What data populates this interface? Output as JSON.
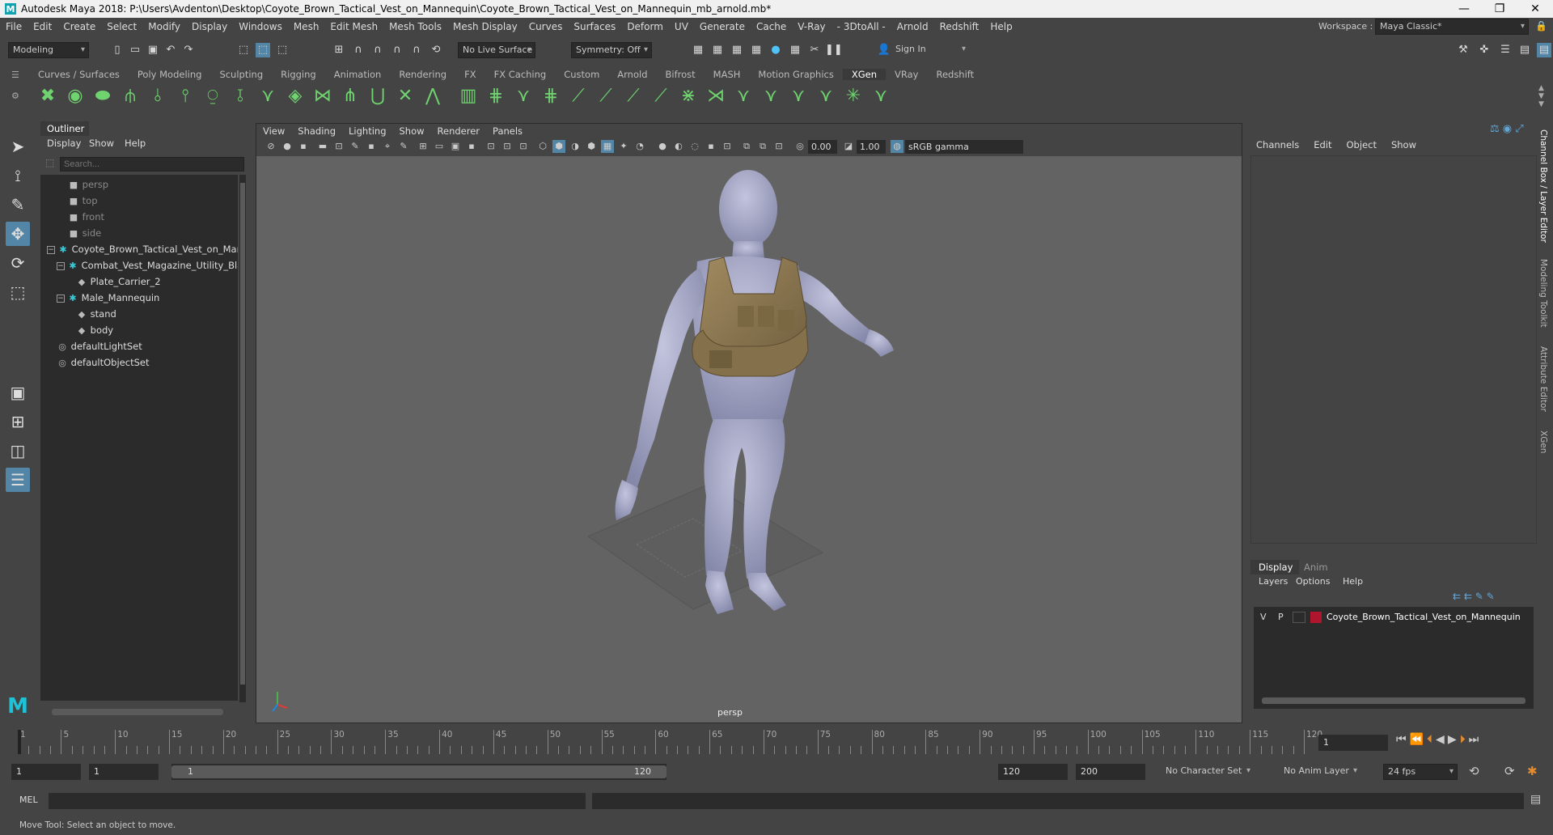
{
  "title_bar": {
    "title": "Autodesk Maya 2018: P:\\Users\\Avdenton\\Desktop\\Coyote_Brown_Tactical_Vest_on_Mannequin\\Coyote_Brown_Tactical_Vest_on_Mannequin_mb_arnold.mb*",
    "logo": "M",
    "minimize": "—",
    "maximize": "❐",
    "close": "✕"
  },
  "menu": [
    "File",
    "Edit",
    "Create",
    "Select",
    "Modify",
    "Display",
    "Windows",
    "Mesh",
    "Edit Mesh",
    "Mesh Tools",
    "Mesh Display",
    "Curves",
    "Surfaces",
    "Deform",
    "UV",
    "Generate",
    "Cache",
    "V-Ray",
    "- 3DtoAll -",
    "Arnold",
    "Redshift",
    "Help"
  ],
  "workspace": {
    "label": "Workspace :",
    "value": "Maya Classic*"
  },
  "status_line": {
    "mode": "Modeling",
    "live_surface": "No Live Surface",
    "symmetry": "Symmetry: Off",
    "sign_in": "Sign In"
  },
  "shelf_tabs": [
    "Curves / Surfaces",
    "Poly Modeling",
    "Sculpting",
    "Rigging",
    "Animation",
    "Rendering",
    "FX",
    "FX Caching",
    "Custom",
    "Arnold",
    "Bifrost",
    "MASH",
    "Motion Graphics",
    "XGen",
    "VRay",
    "Redshift"
  ],
  "shelf_active": "XGen",
  "outliner": {
    "title": "Outliner",
    "menu": [
      "Display",
      "Show",
      "Help"
    ],
    "search_placeholder": "Search...",
    "items": [
      {
        "label": "persp",
        "icon": "camera-icon",
        "dim": true
      },
      {
        "label": "top",
        "icon": "camera-icon",
        "dim": true
      },
      {
        "label": "front",
        "icon": "camera-icon",
        "dim": true
      },
      {
        "label": "side",
        "icon": "camera-icon",
        "dim": true
      },
      {
        "label": "Coyote_Brown_Tactical_Vest_on_Man",
        "icon": "group-icon",
        "dim": false
      },
      {
        "label": "Combat_Vest_Magazine_Utility_Bla",
        "icon": "group-icon",
        "dim": false
      },
      {
        "label": "Plate_Carrier_2",
        "icon": "mesh-icon",
        "dim": false
      },
      {
        "label": "Male_Mannequin",
        "icon": "group-icon",
        "dim": false
      },
      {
        "label": "stand",
        "icon": "mesh-icon",
        "dim": false
      },
      {
        "label": "body",
        "icon": "mesh-icon",
        "dim": false
      },
      {
        "label": "defaultLightSet",
        "icon": "set-icon",
        "dim": false
      },
      {
        "label": "defaultObjectSet",
        "icon": "set-icon",
        "dim": false
      }
    ]
  },
  "viewport": {
    "menu": [
      "View",
      "Shading",
      "Lighting",
      "Show",
      "Renderer",
      "Panels"
    ],
    "exposure": "0.00",
    "gamma": "1.00",
    "color_space": "sRGB gamma",
    "camera": "persp"
  },
  "channel_box": {
    "menu": [
      "Channels",
      "Edit",
      "Object",
      "Show"
    ],
    "vertical_tabs": [
      "Channel Box / Layer Editor",
      "Modeling Toolkit",
      "Attribute Editor",
      "XGen"
    ]
  },
  "layer_editor": {
    "tabs": [
      "Display",
      "Anim"
    ],
    "menu": [
      "Layers",
      "Options",
      "Help"
    ],
    "layer": {
      "v": "V",
      "p": "P",
      "name": "Coyote_Brown_Tactical_Vest_on_Mannequin",
      "color": "#b0152e"
    }
  },
  "time_slider": {
    "labels": [
      "1",
      "5",
      "10",
      "15",
      "20",
      "25",
      "30",
      "35",
      "40",
      "45",
      "50",
      "55",
      "60",
      "65",
      "70",
      "75",
      "80",
      "85",
      "90",
      "95",
      "100",
      "105",
      "110",
      "115",
      "120"
    ],
    "current_frame": "1"
  },
  "range_slider": {
    "start": "1",
    "playback_start": "1",
    "range_start": "1",
    "range_end": "120",
    "playback_end": "120",
    "end": "200",
    "character_set": "No Character Set",
    "anim_layer": "No Anim Layer",
    "fps": "24 fps"
  },
  "command_line": {
    "lang": "MEL"
  },
  "help_line": "Move Tool: Select an object to move.",
  "colors": {
    "accent": "#5285a6",
    "shelf_icon": "#6fd36f",
    "vest": "#8c7a55",
    "body": "#a6a8c8"
  }
}
